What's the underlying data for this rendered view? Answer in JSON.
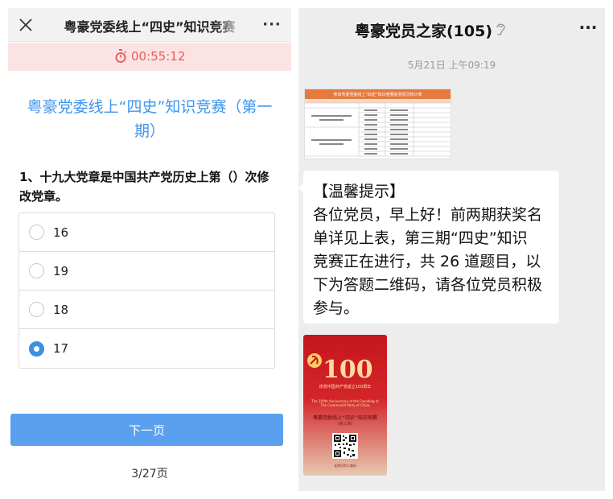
{
  "quiz_page": {
    "header_title": "粤豪党委线上“四史”知识竞赛",
    "more_icon": "more-dots-icon",
    "close_icon": "close-icon",
    "timer": "00:55:12",
    "timer_color": "#e85c5c",
    "quiz_title": "粤豪党委线上“四史”知识竞赛（第一期）",
    "question": "1、十九大党章是中国共产党历史上第（）次修改党章。",
    "options": [
      {
        "label": "16",
        "selected": false
      },
      {
        "label": "19",
        "selected": false
      },
      {
        "label": "18",
        "selected": false
      },
      {
        "label": "17",
        "selected": true
      }
    ],
    "next_button": "下一页",
    "page_counter": "3/27页",
    "accent_color": "#3d95ec"
  },
  "chat": {
    "group_title": "粤豪党员之家(105)",
    "muted_icon": "ear-icon",
    "more_icon": "more-dots-icon",
    "timestamp": "5月21日 上午09:19",
    "table_image": {
      "title": "参加粤豪党委线上“四史”知识竞赛获奖情况统计表"
    },
    "message_lines": [
      "【温馨提示】",
      "各位党员，早上好！前两期获奖名",
      "单详见上表，第三期“四史”知识",
      "竞赛正在进行，共 26 道题目，以",
      "下为答题二维码，请各位党员积极",
      "参与。"
    ],
    "poster": {
      "big_number": "100",
      "subtitle": "庆祝中国共产党成立100周年",
      "subtitle_en": "The 100th Anniversary of the Founding of The Communist Party of China",
      "title": "粤豪党委线上“四史”知识竞赛",
      "issue": "（第三期）",
      "footer": "长按识别二维码"
    }
  }
}
